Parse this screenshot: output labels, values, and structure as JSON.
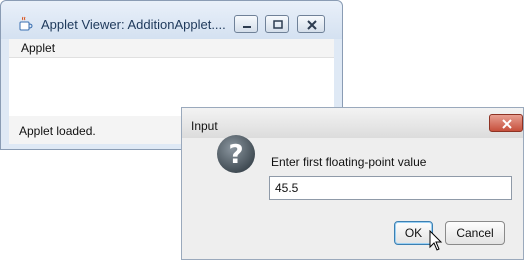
{
  "applet_window": {
    "title": "Applet Viewer: AdditionApplet....",
    "menu": {
      "applet_label": "Applet"
    },
    "status_text": "Applet loaded.",
    "icons": {
      "app": "java-coffee-cup-icon",
      "minimize": "minimize-icon",
      "maximize": "maximize-icon",
      "close": "close-icon"
    }
  },
  "input_dialog": {
    "title": "Input",
    "prompt": "Enter first floating-point value",
    "input_value": "45.5",
    "ok_label": "OK",
    "cancel_label": "Cancel",
    "icons": {
      "question": "question-mark-icon",
      "close": "close-icon",
      "cursor": "mouse-pointer-icon"
    }
  },
  "colors": {
    "window_frame": "#dfe9f5",
    "dialog_close": "#c6503c",
    "question_icon": "#5a6670"
  }
}
